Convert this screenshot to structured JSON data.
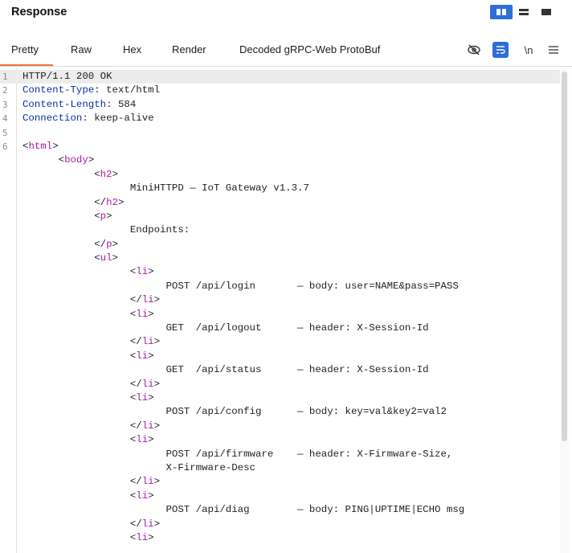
{
  "header": {
    "title": "Response"
  },
  "layout_buttons": [
    "split-view-icon",
    "horizontal-view-icon",
    "single-view-icon"
  ],
  "tabs": [
    {
      "label": "Pretty",
      "active": true
    },
    {
      "label": "Raw"
    },
    {
      "label": "Hex"
    },
    {
      "label": "Render"
    },
    {
      "label": "Decoded gRPC-Web ProtoBuf"
    }
  ],
  "toolbar": {
    "newline_label": "\\n"
  },
  "accent": "#e8743b",
  "lines": [
    {
      "n": "1",
      "segs": [
        {
          "t": "HTTP/1.1 200 OK"
        }
      ]
    },
    {
      "n": "2",
      "segs": [
        {
          "t": "Content-Type",
          "c": "hk"
        },
        {
          "t": ": text/html"
        }
      ]
    },
    {
      "n": "3",
      "segs": [
        {
          "t": "Content-Length",
          "c": "hk"
        },
        {
          "t": ": 584"
        }
      ]
    },
    {
      "n": "4",
      "segs": [
        {
          "t": "Connection",
          "c": "hk"
        },
        {
          "t": ": keep-alive"
        }
      ]
    },
    {
      "n": "5",
      "segs": []
    },
    {
      "n": "6",
      "segs": [
        {
          "t": "<"
        },
        {
          "t": "html",
          "c": "tg"
        },
        {
          "t": ">"
        }
      ]
    },
    {
      "n": "",
      "segs": [
        {
          "t": "      <"
        },
        {
          "t": "body",
          "c": "tg"
        },
        {
          "t": ">"
        }
      ]
    },
    {
      "n": "",
      "segs": [
        {
          "t": "            <"
        },
        {
          "t": "h2",
          "c": "tg"
        },
        {
          "t": ">"
        }
      ]
    },
    {
      "n": "",
      "segs": [
        {
          "t": "                  MiniHTTPD — IoT Gateway v1.3.7"
        }
      ]
    },
    {
      "n": "",
      "segs": [
        {
          "t": "            </"
        },
        {
          "t": "h2",
          "c": "tg"
        },
        {
          "t": ">"
        }
      ]
    },
    {
      "n": "",
      "segs": [
        {
          "t": "            <"
        },
        {
          "t": "p",
          "c": "tg"
        },
        {
          "t": ">"
        }
      ]
    },
    {
      "n": "",
      "segs": [
        {
          "t": "                  Endpoints:"
        }
      ]
    },
    {
      "n": "",
      "segs": [
        {
          "t": "            </"
        },
        {
          "t": "p",
          "c": "tg"
        },
        {
          "t": ">"
        }
      ]
    },
    {
      "n": "",
      "segs": [
        {
          "t": "            <"
        },
        {
          "t": "ul",
          "c": "tg"
        },
        {
          "t": ">"
        }
      ]
    },
    {
      "n": "",
      "segs": [
        {
          "t": "                  <"
        },
        {
          "t": "li",
          "c": "tg"
        },
        {
          "t": ">"
        }
      ]
    },
    {
      "n": "",
      "segs": [
        {
          "t": "                        POST /api/login       — body: user=NAME&pass=PASS"
        }
      ]
    },
    {
      "n": "",
      "segs": [
        {
          "t": "                  </"
        },
        {
          "t": "li",
          "c": "tg"
        },
        {
          "t": ">"
        }
      ]
    },
    {
      "n": "",
      "segs": [
        {
          "t": "                  <"
        },
        {
          "t": "li",
          "c": "tg"
        },
        {
          "t": ">"
        }
      ]
    },
    {
      "n": "",
      "segs": [
        {
          "t": "                        GET  /api/logout      — header: X-Session-Id"
        }
      ]
    },
    {
      "n": "",
      "segs": [
        {
          "t": "                  </"
        },
        {
          "t": "li",
          "c": "tg"
        },
        {
          "t": ">"
        }
      ]
    },
    {
      "n": "",
      "segs": [
        {
          "t": "                  <"
        },
        {
          "t": "li",
          "c": "tg"
        },
        {
          "t": ">"
        }
      ]
    },
    {
      "n": "",
      "segs": [
        {
          "t": "                        GET  /api/status      — header: X-Session-Id"
        }
      ]
    },
    {
      "n": "",
      "segs": [
        {
          "t": "                  </"
        },
        {
          "t": "li",
          "c": "tg"
        },
        {
          "t": ">"
        }
      ]
    },
    {
      "n": "",
      "segs": [
        {
          "t": "                  <"
        },
        {
          "t": "li",
          "c": "tg"
        },
        {
          "t": ">"
        }
      ]
    },
    {
      "n": "",
      "segs": [
        {
          "t": "                        POST /api/config      — body: key=val&key2=val2"
        }
      ]
    },
    {
      "n": "",
      "segs": [
        {
          "t": "                  </"
        },
        {
          "t": "li",
          "c": "tg"
        },
        {
          "t": ">"
        }
      ]
    },
    {
      "n": "",
      "segs": [
        {
          "t": "                  <"
        },
        {
          "t": "li",
          "c": "tg"
        },
        {
          "t": ">"
        }
      ]
    },
    {
      "n": "",
      "segs": [
        {
          "t": "                        POST /api/firmware    — header: X-Firmware-Size,"
        }
      ]
    },
    {
      "n": "",
      "segs": [
        {
          "t": "                        X-Firmware-Desc"
        }
      ]
    },
    {
      "n": "",
      "segs": [
        {
          "t": "                  </"
        },
        {
          "t": "li",
          "c": "tg"
        },
        {
          "t": ">"
        }
      ]
    },
    {
      "n": "",
      "segs": [
        {
          "t": "                  <"
        },
        {
          "t": "li",
          "c": "tg"
        },
        {
          "t": ">"
        }
      ]
    },
    {
      "n": "",
      "segs": [
        {
          "t": "                        POST /api/diag        — body: PING|UPTIME|ECHO msg"
        }
      ]
    },
    {
      "n": "",
      "segs": [
        {
          "t": "                  </"
        },
        {
          "t": "li",
          "c": "tg"
        },
        {
          "t": ">"
        }
      ]
    },
    {
      "n": "",
      "segs": [
        {
          "t": "                  <"
        },
        {
          "t": "li",
          "c": "tg"
        },
        {
          "t": ">"
        }
      ]
    }
  ]
}
